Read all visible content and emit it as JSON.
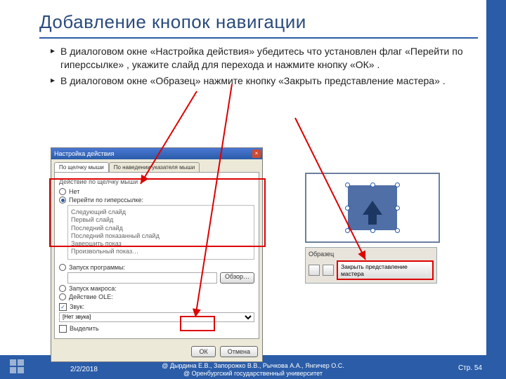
{
  "slide": {
    "title": "Добавление кнопок навигации",
    "bullets": [
      "В диалоговом окне «Настройка действия» убедитесь что установлен флаг «Перейти по гиперссылке» , укажите слайд для перехода и нажмите кнопку «ОК» .",
      "В диалоговом окне «Образец» нажмите кнопку «Закрыть представление мастера» ."
    ]
  },
  "dialog": {
    "title": "Настройка действия",
    "close_x": "×",
    "tabs": {
      "active": "По щелчку мыши",
      "inactive": "По наведении указателя мыши"
    },
    "group_label": "Действие по щелчку мыши",
    "radios": {
      "none": "Нет",
      "hyperlink": "Перейти по гиперссылке:"
    },
    "hyperlink_options": [
      "Следующий слайд",
      "Первый слайд",
      "Последний слайд",
      "Последний показанный слайд",
      "Завершить показ",
      "Произвольный показ…"
    ],
    "radio_run": "Запуск программы:",
    "browse_btn": "Обзор…",
    "radio_macro": "Запуск макроса:",
    "radio_ole": "Действие OLE:",
    "sound_check": "Звук:",
    "sound_value": "[Нет звука]",
    "highlight_check": "Выделить",
    "ok": "ОК",
    "cancel": "Отмена"
  },
  "master_panel": {
    "label": "Образец",
    "close_master": "Закрыть представление мастера"
  },
  "footer": {
    "date": "2/2/2018",
    "authors_line1": "@ Дырдина Е.В., Запорожко В.В., Рычкова А.А., Янгичер О.С.",
    "authors_line2": "@ Оренбургский государственный университет",
    "page": "Стр. 54"
  }
}
